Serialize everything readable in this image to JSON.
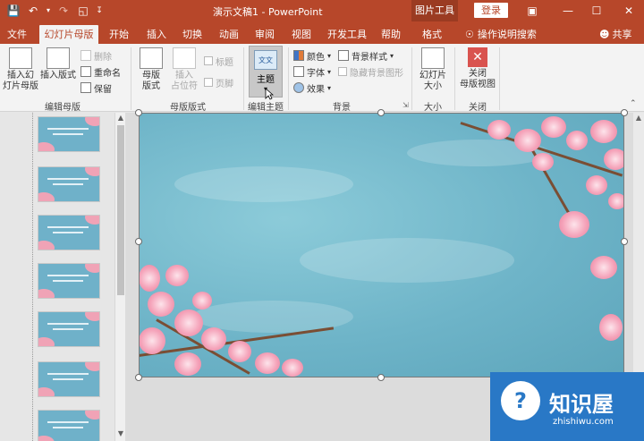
{
  "titlebar": {
    "doc_title": "演示文稿1  -  PowerPoint",
    "picture_tools": "图片工具",
    "login": "登录"
  },
  "tabs": [
    {
      "label": "文件"
    },
    {
      "label": "幻灯片母版"
    },
    {
      "label": "开始"
    },
    {
      "label": "插入"
    },
    {
      "label": "切换"
    },
    {
      "label": "动画"
    },
    {
      "label": "审阅"
    },
    {
      "label": "视图"
    },
    {
      "label": "开发工具"
    },
    {
      "label": "帮助"
    },
    {
      "label": "格式"
    }
  ],
  "tellme": "操作说明搜索",
  "share": "共享",
  "ribbon": {
    "edit_master": {
      "label": "编辑母版",
      "insert_slide_master": "插入幻\n灯片母版",
      "insert_layout": "插入版式",
      "delete": "删除",
      "rename": "重命名",
      "preserve": "保留"
    },
    "master_layout": {
      "label": "母版版式",
      "master_layout": "母版\n版式",
      "insert_placeholder": "插入\n占位符",
      "title": "标题",
      "footer": "页脚"
    },
    "edit_theme": {
      "label": "编辑主题",
      "theme": "主题",
      "theme_icon_text": "文文"
    },
    "background": {
      "label": "背景",
      "colors": "颜色",
      "fonts": "字体",
      "effects": "效果",
      "bg_styles": "背景样式",
      "hide_bg": "隐藏背景图形"
    },
    "size": {
      "label": "大小",
      "slide_size": "幻灯片\n大小"
    },
    "close": {
      "label": "关闭",
      "close_master": "关闭\n母版视图"
    }
  },
  "logo": {
    "name": "知识屋",
    "url": "zhishiwu.com"
  },
  "colors": {
    "accent": "#b7472a",
    "slide_bg": "#6eb4c8",
    "blossom": "#f5a5bb"
  }
}
